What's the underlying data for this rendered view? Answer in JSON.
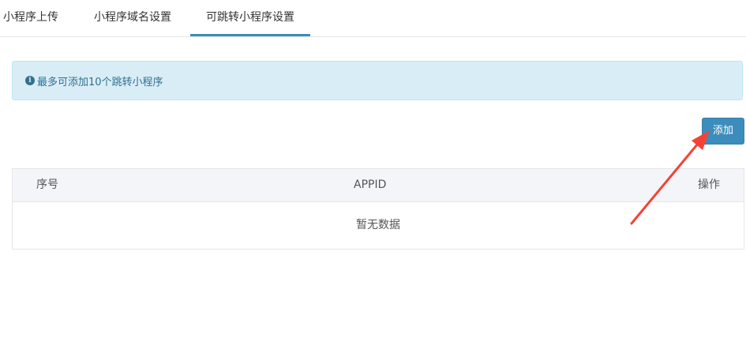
{
  "tabs": [
    {
      "label": "小程序上传"
    },
    {
      "label": "小程序域名设置"
    },
    {
      "label": "可跳转小程序设置"
    }
  ],
  "alert": {
    "text": "最多可添加10个跳转小程序",
    "icon": "info-circle-icon",
    "bg_color": "#d9edf7",
    "text_color": "#31708f"
  },
  "add_button": {
    "label": "添加",
    "color": "#3c8dbc"
  },
  "table": {
    "columns": [
      "序号",
      "APPID",
      "操作"
    ],
    "empty_text": "暂无数据"
  },
  "annotation": {
    "type": "red-arrow-icon",
    "color": "#f44336"
  }
}
